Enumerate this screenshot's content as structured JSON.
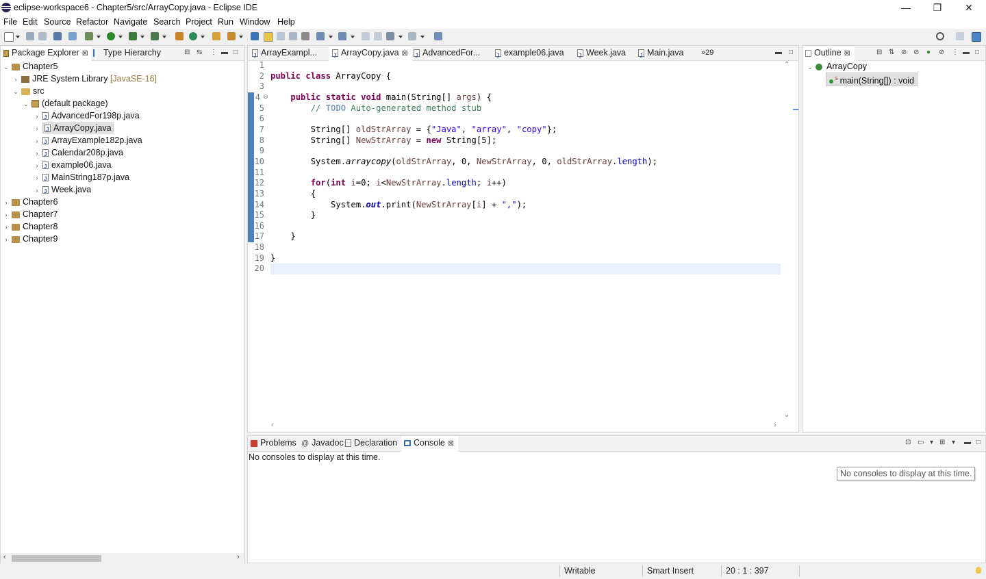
{
  "window": {
    "title": "eclipse-workspace6 - Chapter5/src/ArrayCopy.java - Eclipse IDE",
    "controls": {
      "minimize": "—",
      "maximize": "❐",
      "close": "✕"
    }
  },
  "menu": [
    "File",
    "Edit",
    "Source",
    "Refactor",
    "Navigate",
    "Search",
    "Project",
    "Run",
    "Window",
    "Help"
  ],
  "package_explorer": {
    "tabs": [
      {
        "label": "Package Explorer",
        "close": "⊠"
      },
      {
        "label": "Type Hierarchy"
      }
    ],
    "tree": [
      {
        "label": "Chapter5",
        "twisty": "⌄"
      },
      {
        "label": "JRE System Library",
        "decoration": "[JavaSE-16]",
        "twisty": "›"
      },
      {
        "label": "src",
        "twisty": "⌄"
      },
      {
        "label": "(default package)",
        "twisty": "⌄"
      },
      {
        "label": "AdvancedFor198p.java",
        "twisty": "›"
      },
      {
        "label": "ArrayCopy.java",
        "twisty": "›"
      },
      {
        "label": "ArrayExample182p.java",
        "twisty": "›"
      },
      {
        "label": "Calendar208p.java",
        "twisty": "›"
      },
      {
        "label": "example06.java",
        "twisty": "›"
      },
      {
        "label": "MainString187p.java",
        "twisty": "›"
      },
      {
        "label": "Week.java",
        "twisty": "›"
      },
      {
        "label": "Chapter6",
        "twisty": "›"
      },
      {
        "label": "Chapter7",
        "twisty": "›"
      },
      {
        "label": "Chapter8",
        "twisty": "›"
      },
      {
        "label": "Chapter9",
        "twisty": "›"
      }
    ],
    "selected_item": "ArrayCopy.java"
  },
  "editor": {
    "tabs": [
      {
        "label": "ArrayExampl..."
      },
      {
        "label": "ArrayCopy.java",
        "active": true,
        "close": "⊠"
      },
      {
        "label": "AdvancedFor..."
      },
      {
        "label": "example06.java"
      },
      {
        "label": "Week.java"
      },
      {
        "label": "Main.java"
      }
    ],
    "overflow": "»29",
    "line_numbers": [
      "1",
      "2",
      "3",
      "4",
      "5",
      "6",
      "7",
      "8",
      "9",
      "10",
      "11",
      "12",
      "13",
      "14",
      "15",
      "16",
      "17",
      "18",
      "19",
      "20"
    ],
    "fold_marker": "⊖",
    "current_line": 20
  },
  "outline": {
    "tab": "Outline",
    "class_name": "ArrayCopy",
    "method": "main(String[]) : void",
    "static_marker": "S"
  },
  "console_panel": {
    "tabs": [
      "Problems",
      "Javadoc",
      "Declaration",
      "Console"
    ],
    "active_tab": "Console",
    "message": "No consoles to display at this time.",
    "tooltip": "No consoles to display at this time."
  },
  "status": {
    "mode": "Writable",
    "insert": "Smart Insert",
    "position": "20 : 1 : 397"
  }
}
